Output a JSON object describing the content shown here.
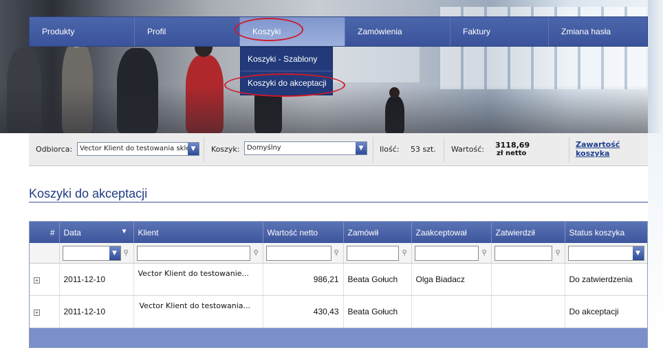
{
  "nav": {
    "items": [
      {
        "label": "Produkty"
      },
      {
        "label": "Profil"
      },
      {
        "label": "Koszyki"
      },
      {
        "label": "Zamówienia"
      },
      {
        "label": "Faktury"
      },
      {
        "label": "Zmiana hasła"
      }
    ],
    "submenu": [
      {
        "label": "Koszyki - Szablony"
      },
      {
        "label": "Koszyki do akceptacji"
      }
    ]
  },
  "context": {
    "recipient_label": "Odbiorca:",
    "recipient_value": "Vector Klient do testowania skle",
    "cart_label": "Koszyk:",
    "cart_value": "Domyślny",
    "qty_label": "Ilość:",
    "qty_value": "53 szt.",
    "value_label": "Wartość:",
    "value_amount": "3118,69",
    "value_unit": "zł netto",
    "cart_contents_link_1": "Zawartość",
    "cart_contents_link_2": "koszyka"
  },
  "page": {
    "title": "Koszyki do akceptacji"
  },
  "grid": {
    "columns": [
      "#",
      "Data",
      "Klient",
      "Wartość netto",
      "Zamówił",
      "Zaakceptował",
      "Zatwierdził",
      "Status koszyka"
    ],
    "rows": [
      {
        "date": "2011-12-10",
        "client": "Vector Klient do testowanie...",
        "value": "986,21",
        "ordered_by": "Beata Gołuch",
        "accepted_by": "Olga Biadacz",
        "approved_by": "",
        "status": "Do zatwierdzenia"
      },
      {
        "date": "2011-12-10",
        "client": "Vector Klient do testowania...",
        "value": "430,43",
        "ordered_by": "Beata Gołuch",
        "accepted_by": "",
        "approved_by": "",
        "status": "Do akceptacji"
      }
    ]
  },
  "colors": {
    "nav_bg": "#3a539b",
    "nav_active": "#9eb0dc",
    "submenu_bg": "#223a7a",
    "highlight_ellipse": "#d11a2a",
    "title_color": "#1f3b82",
    "grid_footer": "#7b90ca"
  }
}
